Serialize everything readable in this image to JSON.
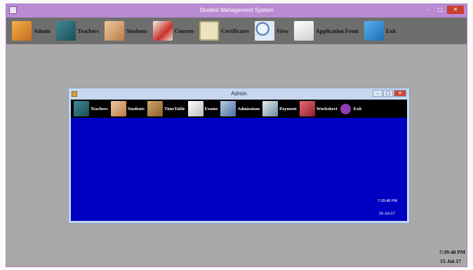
{
  "window": {
    "title": "Student Management System",
    "minimize": "–",
    "maximize": "□",
    "close": "✕"
  },
  "menu": [
    {
      "label": "Admin",
      "icon": "admin-icon",
      "color": "#d48a2a"
    },
    {
      "label": "Teachers",
      "icon": "teachers-icon",
      "color": "#2e6b76"
    },
    {
      "label": "Students",
      "icon": "students-icon",
      "color": "#d9a373"
    },
    {
      "label": "Courses",
      "icon": "courses-icon",
      "color": "#e8e2da"
    },
    {
      "label": "Certificates",
      "icon": "certificates-icon",
      "color": "#ece3c1"
    },
    {
      "label": "View",
      "icon": "view-icon",
      "color": "#dfe9f5"
    },
    {
      "label": "Application From",
      "icon": "application-icon",
      "color": "#f2f2f2"
    },
    {
      "label": "Exit",
      "icon": "exit-icon",
      "color": "#2d8ed8"
    }
  ],
  "status": {
    "time": "7:39:48 PM",
    "date": "15-Jul-17"
  },
  "child": {
    "title": "Admin",
    "menu": [
      {
        "label": "Teachers",
        "icon": "teachers-icon",
        "color": "#2e6b76"
      },
      {
        "label": "Students",
        "icon": "students-icon",
        "color": "#d9a373"
      },
      {
        "label": "TimeTable",
        "icon": "timetable-icon",
        "color": "#b58a4a"
      },
      {
        "label": "Exams",
        "icon": "exams-icon",
        "color": "#e6e6e6"
      },
      {
        "label": "Admissions",
        "icon": "admissions-icon",
        "color": "#8fa7c8"
      },
      {
        "label": "Payment",
        "icon": "payment-icon",
        "color": "#c9d6e0"
      },
      {
        "label": "Worksheet",
        "icon": "worksheet-icon",
        "color": "#c23a4a"
      },
      {
        "label": "Exit",
        "icon": "exit-icon",
        "color": "#8e3fb0"
      }
    ],
    "time": "7:39:48 PM",
    "date": "15-Jul-17"
  }
}
